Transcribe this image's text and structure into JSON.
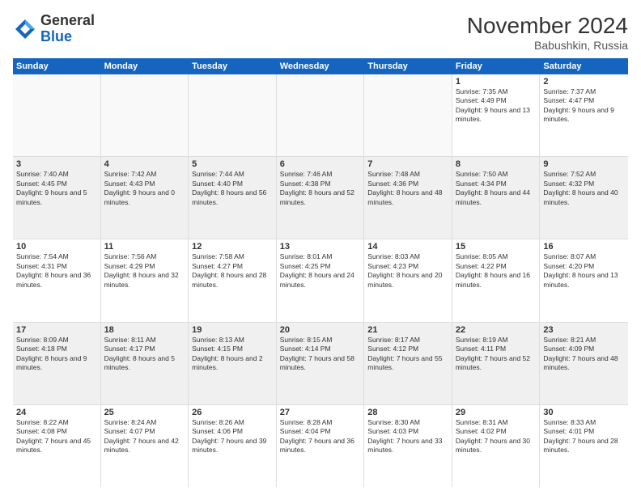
{
  "logo": {
    "general": "General",
    "blue": "Blue"
  },
  "title": "November 2024",
  "subtitle": "Babushkin, Russia",
  "days_of_week": [
    "Sunday",
    "Monday",
    "Tuesday",
    "Wednesday",
    "Thursday",
    "Friday",
    "Saturday"
  ],
  "weeks": [
    [
      {
        "day": "",
        "info": ""
      },
      {
        "day": "",
        "info": ""
      },
      {
        "day": "",
        "info": ""
      },
      {
        "day": "",
        "info": ""
      },
      {
        "day": "",
        "info": ""
      },
      {
        "day": "1",
        "info": "Sunrise: 7:35 AM\nSunset: 4:49 PM\nDaylight: 9 hours and 13 minutes."
      },
      {
        "day": "2",
        "info": "Sunrise: 7:37 AM\nSunset: 4:47 PM\nDaylight: 9 hours and 9 minutes."
      }
    ],
    [
      {
        "day": "3",
        "info": "Sunrise: 7:40 AM\nSunset: 4:45 PM\nDaylight: 9 hours and 5 minutes."
      },
      {
        "day": "4",
        "info": "Sunrise: 7:42 AM\nSunset: 4:43 PM\nDaylight: 9 hours and 0 minutes."
      },
      {
        "day": "5",
        "info": "Sunrise: 7:44 AM\nSunset: 4:40 PM\nDaylight: 8 hours and 56 minutes."
      },
      {
        "day": "6",
        "info": "Sunrise: 7:46 AM\nSunset: 4:38 PM\nDaylight: 8 hours and 52 minutes."
      },
      {
        "day": "7",
        "info": "Sunrise: 7:48 AM\nSunset: 4:36 PM\nDaylight: 8 hours and 48 minutes."
      },
      {
        "day": "8",
        "info": "Sunrise: 7:50 AM\nSunset: 4:34 PM\nDaylight: 8 hours and 44 minutes."
      },
      {
        "day": "9",
        "info": "Sunrise: 7:52 AM\nSunset: 4:32 PM\nDaylight: 8 hours and 40 minutes."
      }
    ],
    [
      {
        "day": "10",
        "info": "Sunrise: 7:54 AM\nSunset: 4:31 PM\nDaylight: 8 hours and 36 minutes."
      },
      {
        "day": "11",
        "info": "Sunrise: 7:56 AM\nSunset: 4:29 PM\nDaylight: 8 hours and 32 minutes."
      },
      {
        "day": "12",
        "info": "Sunrise: 7:58 AM\nSunset: 4:27 PM\nDaylight: 8 hours and 28 minutes."
      },
      {
        "day": "13",
        "info": "Sunrise: 8:01 AM\nSunset: 4:25 PM\nDaylight: 8 hours and 24 minutes."
      },
      {
        "day": "14",
        "info": "Sunrise: 8:03 AM\nSunset: 4:23 PM\nDaylight: 8 hours and 20 minutes."
      },
      {
        "day": "15",
        "info": "Sunrise: 8:05 AM\nSunset: 4:22 PM\nDaylight: 8 hours and 16 minutes."
      },
      {
        "day": "16",
        "info": "Sunrise: 8:07 AM\nSunset: 4:20 PM\nDaylight: 8 hours and 13 minutes."
      }
    ],
    [
      {
        "day": "17",
        "info": "Sunrise: 8:09 AM\nSunset: 4:18 PM\nDaylight: 8 hours and 9 minutes."
      },
      {
        "day": "18",
        "info": "Sunrise: 8:11 AM\nSunset: 4:17 PM\nDaylight: 8 hours and 5 minutes."
      },
      {
        "day": "19",
        "info": "Sunrise: 8:13 AM\nSunset: 4:15 PM\nDaylight: 8 hours and 2 minutes."
      },
      {
        "day": "20",
        "info": "Sunrise: 8:15 AM\nSunset: 4:14 PM\nDaylight: 7 hours and 58 minutes."
      },
      {
        "day": "21",
        "info": "Sunrise: 8:17 AM\nSunset: 4:12 PM\nDaylight: 7 hours and 55 minutes."
      },
      {
        "day": "22",
        "info": "Sunrise: 8:19 AM\nSunset: 4:11 PM\nDaylight: 7 hours and 52 minutes."
      },
      {
        "day": "23",
        "info": "Sunrise: 8:21 AM\nSunset: 4:09 PM\nDaylight: 7 hours and 48 minutes."
      }
    ],
    [
      {
        "day": "24",
        "info": "Sunrise: 8:22 AM\nSunset: 4:08 PM\nDaylight: 7 hours and 45 minutes."
      },
      {
        "day": "25",
        "info": "Sunrise: 8:24 AM\nSunset: 4:07 PM\nDaylight: 7 hours and 42 minutes."
      },
      {
        "day": "26",
        "info": "Sunrise: 8:26 AM\nSunset: 4:06 PM\nDaylight: 7 hours and 39 minutes."
      },
      {
        "day": "27",
        "info": "Sunrise: 8:28 AM\nSunset: 4:04 PM\nDaylight: 7 hours and 36 minutes."
      },
      {
        "day": "28",
        "info": "Sunrise: 8:30 AM\nSunset: 4:03 PM\nDaylight: 7 hours and 33 minutes."
      },
      {
        "day": "29",
        "info": "Sunrise: 8:31 AM\nSunset: 4:02 PM\nDaylight: 7 hours and 30 minutes."
      },
      {
        "day": "30",
        "info": "Sunrise: 8:33 AM\nSunset: 4:01 PM\nDaylight: 7 hours and 28 minutes."
      }
    ]
  ]
}
